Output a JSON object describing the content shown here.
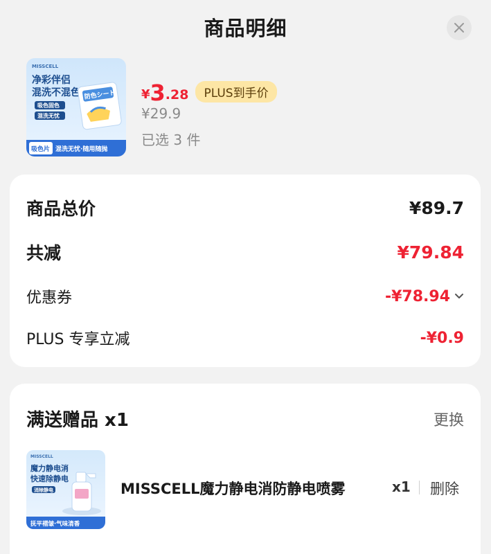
{
  "header": {
    "title": "商品明细"
  },
  "product": {
    "image_texts": {
      "brand": "MISSCELL",
      "headline_1": "净彩伴侣",
      "headline_2": "混洗不混色",
      "tag_1": "吸色固色",
      "tag_2": "混洗无忧",
      "pack_label": "防色シート",
      "footer_tag": "吸色片",
      "footer_slogan": "混洗无忧·随用随抛"
    },
    "price_symbol": "¥",
    "price_int": "3",
    "price_dec": ".28",
    "plus_badge": "PLUS到手价",
    "original_price": "¥29.9",
    "selected_count": "已选 3 件"
  },
  "summary": {
    "total_label": "商品总价",
    "total_value": "¥89.7",
    "reduce_label": "共减",
    "reduce_value": "¥79.84",
    "coupon_label": "优惠券",
    "coupon_value": "-¥78.94",
    "plus_label": "PLUS 专享立减",
    "plus_value": "-¥0.9"
  },
  "gift": {
    "title": "满送赠品 x1",
    "change_label": "更换",
    "item": {
      "image_texts": {
        "brand": "MISSCELL",
        "headline_1": "魔力静电消",
        "headline_2": "快速除静电",
        "tag": "消除静电",
        "footer": "抚平褶皱·气味清香"
      },
      "name": "MISSCELL魔力静电消防静电喷雾",
      "qty": "x1",
      "delete_label": "删除"
    }
  },
  "colors": {
    "accent_red": "#ee2233",
    "plus_badge_bg": "#fde6a5",
    "page_bg": "#f2f2f2",
    "thumb_blue": "#3a86e0"
  }
}
